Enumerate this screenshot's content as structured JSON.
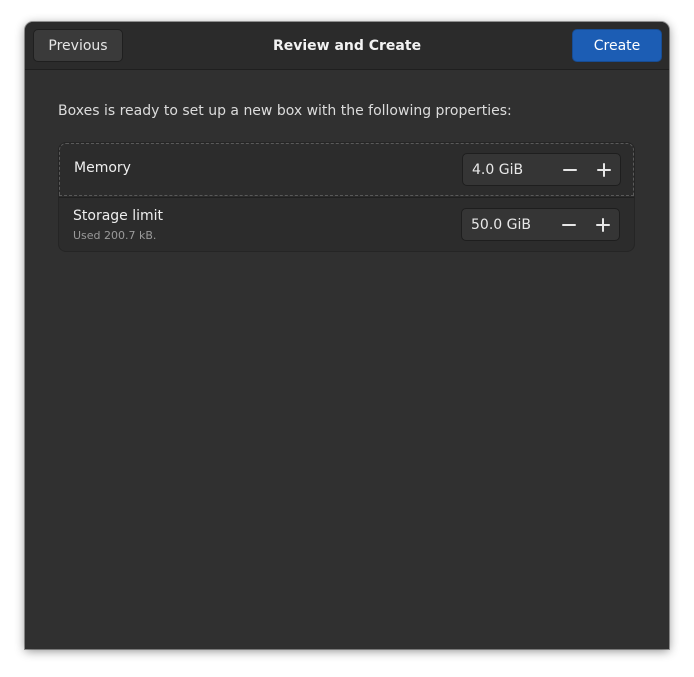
{
  "header": {
    "title": "Review and Create",
    "previous_label": "Previous",
    "create_label": "Create",
    "accent_color": "#1c5db4"
  },
  "main": {
    "intro": "Boxes is ready to set up a new box with the following properties:",
    "properties": [
      {
        "label": "Memory",
        "value": "4.0 GiB",
        "decrement_icon": "minus-icon",
        "increment_icon": "plus-icon"
      },
      {
        "label": "Storage limit",
        "subtitle": "Used 200.7 kB.",
        "value": "50.0 GiB",
        "decrement_icon": "minus-icon",
        "increment_icon": "plus-icon"
      }
    ]
  }
}
